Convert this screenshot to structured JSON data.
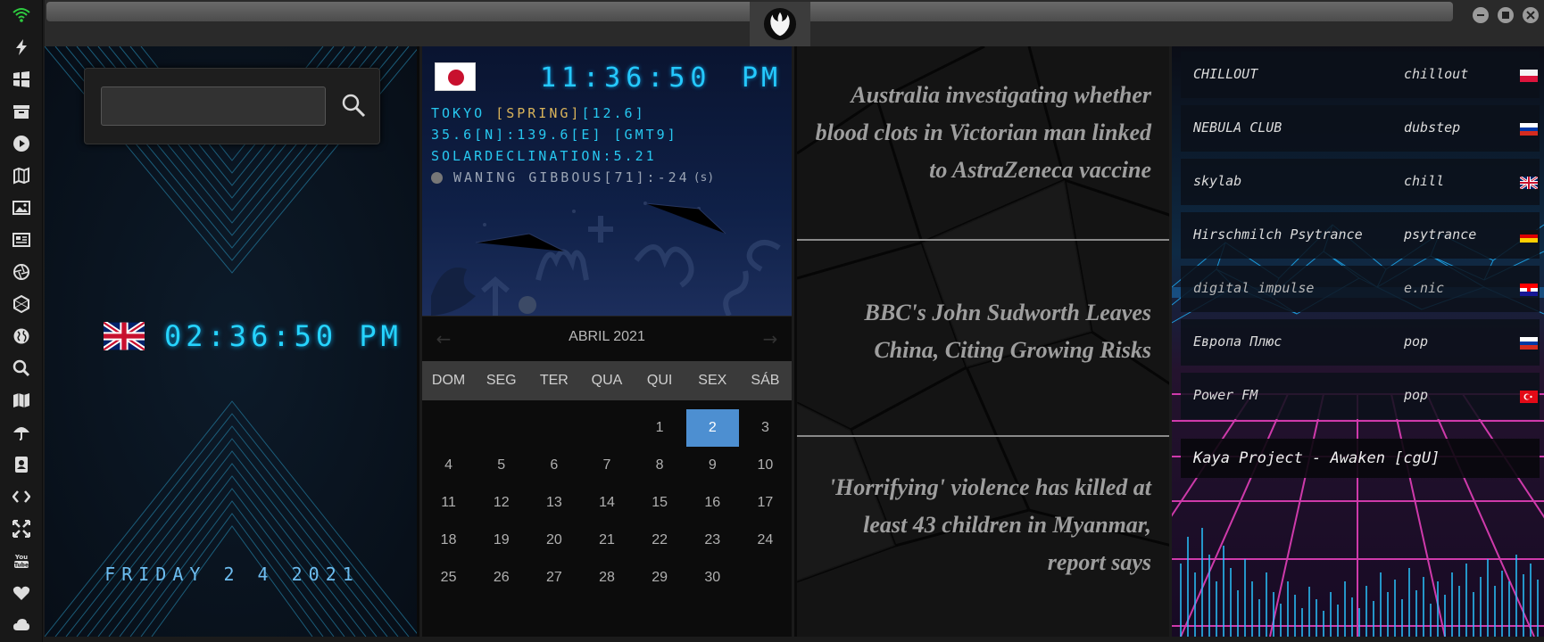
{
  "sidebar": {
    "icons": [
      "wifi-icon",
      "bolt-icon",
      "windows-icon",
      "archive-icon",
      "play-icon",
      "map-book-icon",
      "image-icon",
      "news-icon",
      "aperture-icon",
      "hexagon-icon",
      "globe-icon",
      "search-icon",
      "map-icon",
      "umbrella-icon",
      "contacts-icon",
      "code-icon",
      "expand-icon",
      "youtube-icon",
      "heart-icon",
      "cloud-icon"
    ]
  },
  "colors": {
    "accent_cyan": "#26d4ff",
    "today": "#4d8fd1",
    "wifi_green": "#2ecc40"
  },
  "search": {
    "placeholder": "",
    "value": ""
  },
  "uk_clock": {
    "time": "02:36:50 PM",
    "date": "FRIDAY 2 4 2021"
  },
  "tokyo": {
    "time": "11:36:50",
    "ampm": "PM",
    "line1_city": "TOKYO ",
    "line1_season": "[SPRING]",
    "line1_temp": "[12.6]",
    "line2": "35.6[N]:139.6[E] [GMT9]",
    "line3": "SOLARDECLINATION:5.21",
    "moon": "WANING GIBBOUS[71]:-24",
    "moon_unit": "(s)"
  },
  "calendar": {
    "month": "ABRIL 2021",
    "prev": "←",
    "next": "→",
    "dow": [
      "DOM",
      "SEG",
      "TER",
      "QUA",
      "QUI",
      "SEX",
      "SÁB"
    ],
    "days": [
      "",
      "",
      "",
      "",
      "1",
      "2",
      "3",
      "4",
      "5",
      "6",
      "7",
      "8",
      "9",
      "10",
      "11",
      "12",
      "13",
      "14",
      "15",
      "16",
      "17",
      "18",
      "19",
      "20",
      "21",
      "22",
      "23",
      "24",
      "25",
      "26",
      "27",
      "28",
      "29",
      "30",
      ""
    ],
    "today": "2"
  },
  "news": [
    "Australia investigating whether blood clots in Victorian man linked to AstraZeneca vaccine",
    "BBC's John Sudworth Leaves China, Citing Growing Risks",
    "'Horrifying' violence has killed at least 43 children in Myanmar, report says"
  ],
  "radio": {
    "stations": [
      {
        "name": "CHILLOUT",
        "genre": "chillout",
        "flag": "pl"
      },
      {
        "name": "NEBULA CLUB",
        "genre": "dubstep",
        "flag": "ru"
      },
      {
        "name": "skylab",
        "genre": "chill",
        "flag": "uk"
      },
      {
        "name": "Hirschmilch Psytrance",
        "genre": "psytrance",
        "flag": "de"
      },
      {
        "name": "digital impulse",
        "genre": "e.nic",
        "flag": "hr"
      },
      {
        "name": "Европа Плюс",
        "genre": "pop",
        "flag": "ru"
      },
      {
        "name": "Power FM",
        "genre": "pop",
        "flag": "tr"
      }
    ],
    "now_playing": "Kaya Project - Awaken [cgU]"
  }
}
